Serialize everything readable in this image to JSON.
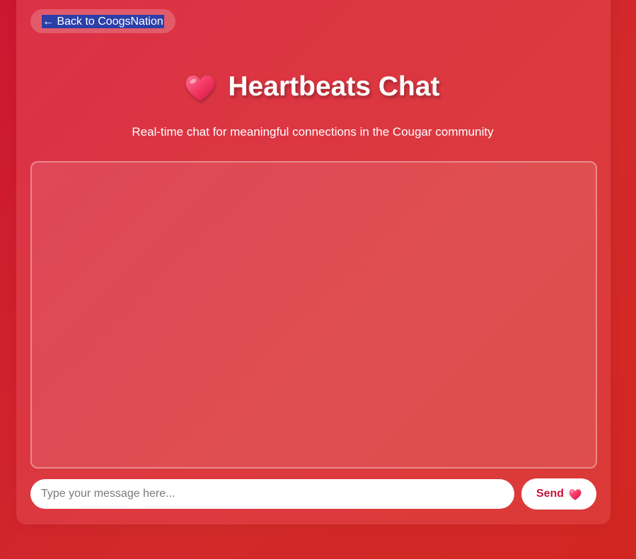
{
  "nav": {
    "back_label": "← Back to CoogsNation"
  },
  "header": {
    "title": "Heartbeats Chat",
    "subtitle": "Real-time chat for meaningful connections in the Cougar community",
    "icon": "heart-icon"
  },
  "chat": {
    "messages": []
  },
  "composer": {
    "placeholder": "Type your message here...",
    "value": "",
    "send_label": "Send",
    "send_icon": "heart-icon"
  },
  "colors": {
    "background": "#cc1730",
    "accent": "#c4173a",
    "heart": "#f0325e",
    "selection": "#2b3fa8"
  }
}
